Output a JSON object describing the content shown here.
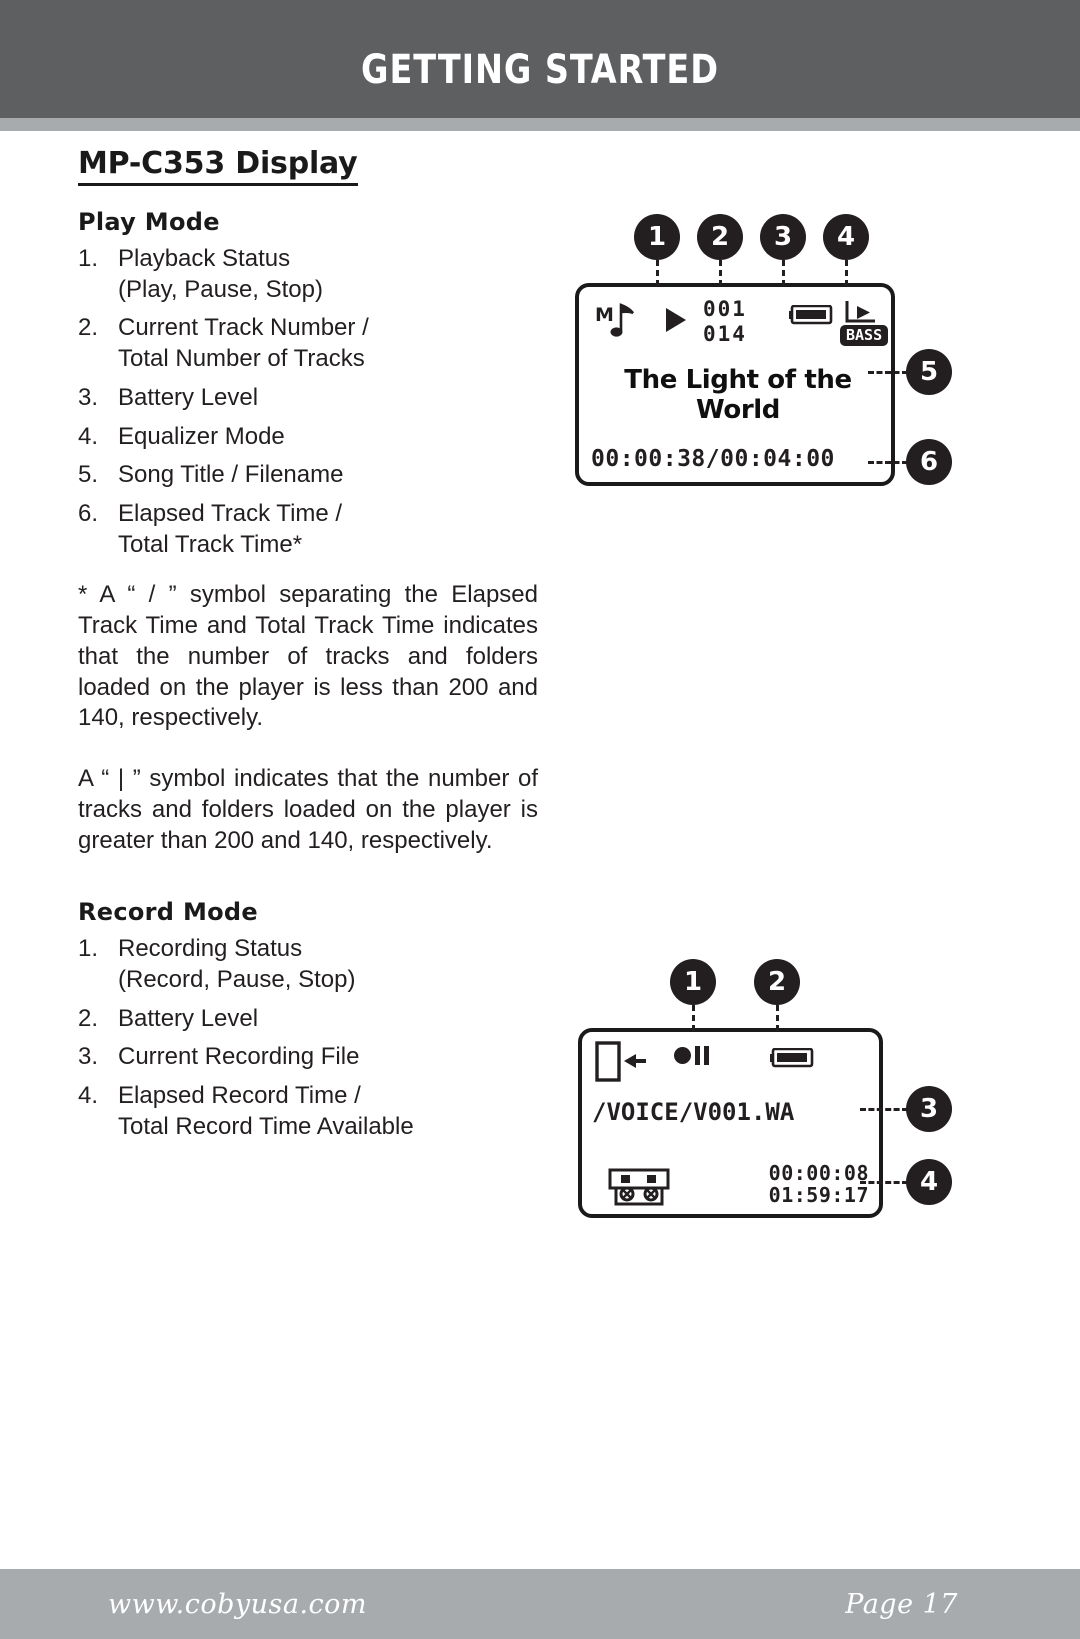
{
  "header": {
    "title": "GETTING STARTED"
  },
  "page_title": "MP-C353 Display",
  "play_mode": {
    "heading": "Play Mode",
    "items": [
      {
        "n": "1.",
        "text": "Playback Status\n(Play, Pause, Stop)"
      },
      {
        "n": "2.",
        "text": "Current Track Number /\nTotal Number of Tracks"
      },
      {
        "n": "3.",
        "text": "Battery Level"
      },
      {
        "n": "4.",
        "text": "Equalizer Mode"
      },
      {
        "n": "5.",
        "text": "Song Title / Filename"
      },
      {
        "n": "6.",
        "text": "Elapsed Track Time /\nTotal Track Time*"
      }
    ],
    "note_1": "* A “ / ” symbol separating the Elapsed Track Time and Total Track Time indicates that the number of tracks and folders loaded on the player is less than 200 and 140, respectively.",
    "note_2": "A “ | ” symbol indicates that the number of tracks and folders loaded on the player is greater than 200 and 140, respectively."
  },
  "record_mode": {
    "heading": "Record Mode",
    "items": [
      {
        "n": "1.",
        "text": "Recording Status\n(Record, Pause, Stop)"
      },
      {
        "n": "2.",
        "text": "Battery Level"
      },
      {
        "n": "3.",
        "text": "Current Recording File"
      },
      {
        "n": "4.",
        "text": "Elapsed Record Time /\nTotal Record Time Available"
      }
    ]
  },
  "play_lcd": {
    "callouts": [
      "1",
      "2",
      "3",
      "4",
      "5",
      "6"
    ],
    "icons": {
      "music": "music-note-icon",
      "playback": "play-triangle-icon",
      "battery": "battery-icon",
      "equalizer": "equalizer-folder-play-icon"
    },
    "track_current": "001",
    "track_total": "014",
    "eq_badge": "BASS",
    "song_title": "The Light of the World",
    "time_elapsed": "00:00:38",
    "time_separator": "/",
    "time_total": "00:04:00",
    "time_full": "00:00:38/00:04:00"
  },
  "record_lcd": {
    "callouts": [
      "1",
      "2",
      "3",
      "4"
    ],
    "icons": {
      "memory": "memory-card-arrow-icon",
      "status": "record-pause-icon",
      "battery": "battery-icon",
      "cassette": "cassette-tape-icon"
    },
    "file_path": "/VOICE/V001.WA",
    "time_elapsed": "00:00:08",
    "time_available": "01:59:17"
  },
  "footer": {
    "url": "www.cobyusa.com",
    "page": "Page 17"
  },
  "colors": {
    "header_bg": "#5d5f61",
    "strip": "#a7abae",
    "footer_bg": "#a7abae",
    "ink": "#231f20",
    "paper": "#ffffff"
  }
}
